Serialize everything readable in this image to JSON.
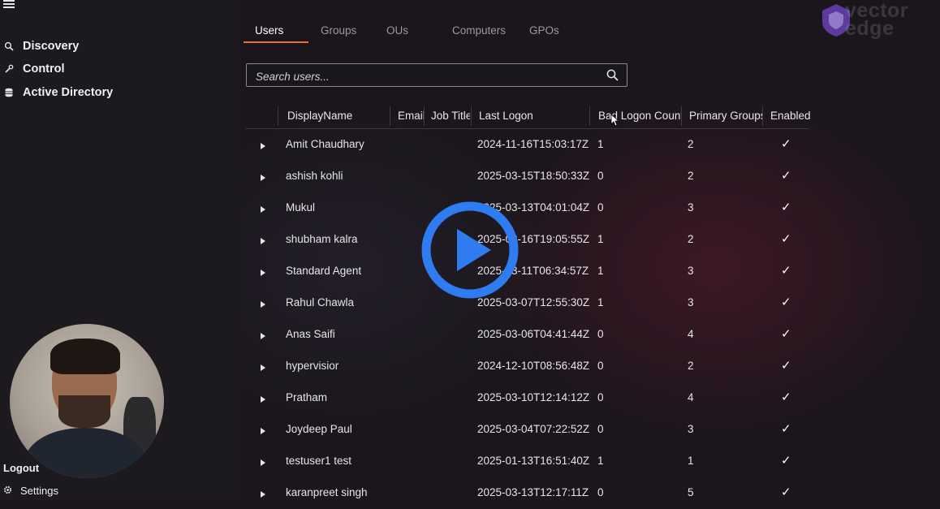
{
  "sidebar": {
    "items": [
      {
        "label": "Discovery",
        "icon": "search-icon"
      },
      {
        "label": "Control",
        "icon": "wrench-icon"
      },
      {
        "label": "Active Directory",
        "icon": "database-icon"
      }
    ],
    "logout_label": "Logout",
    "settings_label": "Settings"
  },
  "tabs": [
    {
      "label": "Users",
      "active": true
    },
    {
      "label": "Groups",
      "active": false
    },
    {
      "label": "OUs",
      "active": false
    },
    {
      "label": "Computers",
      "active": false
    },
    {
      "label": "GPOs",
      "active": false
    }
  ],
  "search": {
    "placeholder": "Search users..."
  },
  "table": {
    "columns": [
      "DisplayName",
      "Email",
      "Job Title",
      "Last Logon",
      "Bad Logon Count",
      "Primary Groups",
      "Enabled"
    ],
    "rows": [
      {
        "name": "Amit Chaudhary",
        "last_logon": "2024-11-16T15:03:17Z",
        "bad_logon": "1",
        "groups": "2",
        "enabled": "✓"
      },
      {
        "name": "ashish kohli",
        "last_logon": "2025-03-15T18:50:33Z",
        "bad_logon": "0",
        "groups": "2",
        "enabled": "✓"
      },
      {
        "name": "Mukul",
        "last_logon": "2025-03-13T04:01:04Z",
        "bad_logon": "0",
        "groups": "3",
        "enabled": "✓"
      },
      {
        "name": "shubham kalra",
        "last_logon": "2025-03-16T19:05:55Z",
        "bad_logon": "1",
        "groups": "2",
        "enabled": "✓"
      },
      {
        "name": "Standard Agent",
        "last_logon": "2025-03-11T06:34:57Z",
        "bad_logon": "1",
        "groups": "3",
        "enabled": "✓"
      },
      {
        "name": "Rahul Chawla",
        "last_logon": "2025-03-07T12:55:30Z",
        "bad_logon": "1",
        "groups": "3",
        "enabled": "✓"
      },
      {
        "name": "Anas Saifi",
        "last_logon": "2025-03-06T04:41:44Z",
        "bad_logon": "0",
        "groups": "4",
        "enabled": "✓"
      },
      {
        "name": "hypervisior",
        "last_logon": "2024-12-10T08:56:48Z",
        "bad_logon": "0",
        "groups": "2",
        "enabled": "✓"
      },
      {
        "name": "Pratham",
        "last_logon": "2025-03-10T12:14:12Z",
        "bad_logon": "0",
        "groups": "4",
        "enabled": "✓"
      },
      {
        "name": "Joydeep Paul",
        "last_logon": "2025-03-04T07:22:52Z",
        "bad_logon": "0",
        "groups": "3",
        "enabled": "✓"
      },
      {
        "name": "testuser1 test",
        "last_logon": "2025-01-13T16:51:40Z",
        "bad_logon": "1",
        "groups": "1",
        "enabled": "✓"
      },
      {
        "name": "karanpreet singh",
        "last_logon": "2025-03-13T12:17:11Z",
        "bad_logon": "0",
        "groups": "5",
        "enabled": "✓"
      }
    ]
  },
  "brand": {
    "line1": "vector",
    "line2": "edge"
  },
  "colors": {
    "accent": "#e8702a",
    "play": "#2f7bf0",
    "logo_shield": "#6b3fb5"
  }
}
